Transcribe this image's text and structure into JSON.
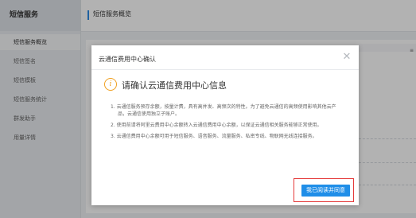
{
  "sidebar": {
    "title": "短信服务",
    "items": [
      {
        "label": "短信服务概览"
      },
      {
        "label": "短信签名"
      },
      {
        "label": "短信模板"
      },
      {
        "label": "短信服务统计"
      },
      {
        "label": "群发助手"
      },
      {
        "label": "用量详情"
      }
    ]
  },
  "header": {
    "title": "短信服务概览"
  },
  "modal": {
    "title": "云通信费用中心确认",
    "close_icon": "close-icon",
    "heading": "请确认云通信费用中心信息",
    "warning_icon": "info-icon",
    "items": [
      "1. 云通信服务预存余额，按量计费，具有高并发、高频次的特性。为了避免云通信的高频使用影响其他云产品，云通信使用独立子账户。",
      "2. 使用前请将阿里云费用中心余额转入云通信费用中心余额，以保证云通信相关服务能够正常使用。",
      "3. 云通信费用中心余额可用于短信服务、语音服务、流量服务、私密专线、物联网无线连接服务。"
    ],
    "confirm_label": "我已阅读并同意"
  },
  "colors": {
    "accent": "#1f8ee8",
    "warning": "#f0a020",
    "highlight": "#e53b3b"
  }
}
